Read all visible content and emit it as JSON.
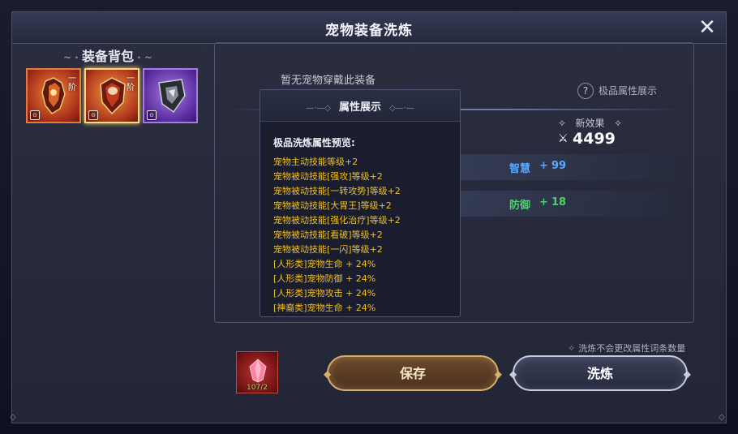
{
  "window": {
    "title": "宠物装备洗炼",
    "close_icon": "close-icon"
  },
  "bag": {
    "title": "装备背包",
    "items": [
      {
        "name": "claw-gauntlet",
        "tier": "一阶",
        "frame_color": "#e77a3a",
        "selected": false
      },
      {
        "name": "crimson-armor",
        "tier": "一阶",
        "frame_color": "#ffd980",
        "selected": true
      },
      {
        "name": "steel-shield",
        "tier": "",
        "frame_color": "#a77ce0",
        "selected": false
      }
    ]
  },
  "status": {
    "no_equipment": "暂无宠物穿戴此装备"
  },
  "premium_attr": {
    "label": "极品属性展示",
    "icon": "question-icon"
  },
  "new_effect": {
    "label": "新效果",
    "power": "4499",
    "stats": [
      {
        "name": "智慧",
        "plus": "+",
        "value": "99",
        "color": "#5aa8ff"
      },
      {
        "name": "防御",
        "plus": "+",
        "value": "18",
        "color": "#4ed06a"
      }
    ]
  },
  "tooltip": {
    "title": "属性展示",
    "preview_label": "极品洗炼属性预览:",
    "lines": [
      "宠物主动技能等级+2",
      "宠物被动技能[强攻]等级+2",
      "宠物被动技能[一转攻势]等级+2",
      "宠物被动技能[大胃王]等级+2",
      "宠物被动技能[强化治疗]等级+2",
      "宠物被动技能[看破]等级+2",
      "宠物被动技能[一闪]等级+2",
      "[人形类]宠物生命 + 24%",
      "[人形类]宠物防御 + 24%",
      "[人形类]宠物攻击 + 24%",
      "[神裔类]宠物生命 + 24%"
    ]
  },
  "note": "洗炼不会更改属性词条数量",
  "material": {
    "count": "107/2",
    "icon": "refine-crystal-icon"
  },
  "buttons": {
    "save": "保存",
    "refine": "洗炼"
  },
  "colors": {
    "gold_text": "#f0c020",
    "accent_blue": "#5aa8ff",
    "accent_green": "#4ed06a"
  }
}
